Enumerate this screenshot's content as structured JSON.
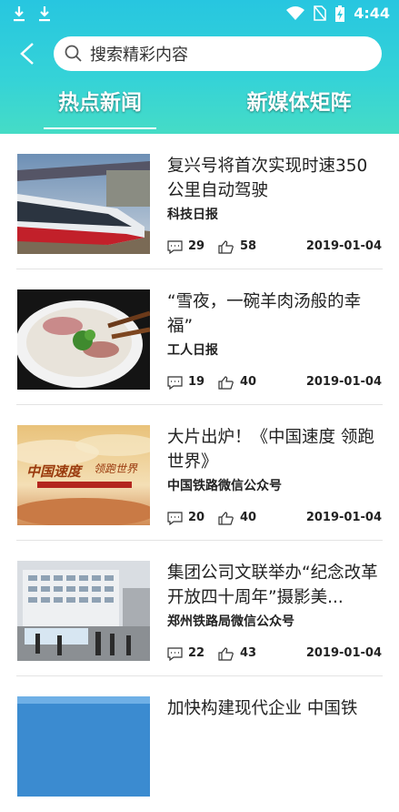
{
  "status": {
    "time": "4:44"
  },
  "search": {
    "placeholder": "搜索精彩内容"
  },
  "tabs": [
    {
      "label": "热点新闻",
      "active": true
    },
    {
      "label": "新媒体矩阵",
      "active": false
    }
  ],
  "colors": {
    "header_top": "#27c6e0",
    "header_bottom": "#45dcc6"
  },
  "articles": [
    {
      "title": "复兴号将首次实现时速350公里自动驾驶",
      "source": "科技日报",
      "comments": "29",
      "likes": "58",
      "date": "2019-01-04",
      "image": "high-speed-train"
    },
    {
      "title": "“雪夜，一碗羊肉汤般的幸福”",
      "source": "工人日报",
      "comments": "19",
      "likes": "40",
      "date": "2019-01-04",
      "image": "mutton-soup-bowl"
    },
    {
      "title": "大片出炉！《中国速度 领跑世界》",
      "source": "中国铁路微信公众号",
      "comments": "20",
      "likes": "40",
      "date": "2019-01-04",
      "image": "china-speed-banner"
    },
    {
      "title": "集团公司文联举办“纪念改革开放四十周年”摄影美...",
      "source": "郑州铁路局微信公众号",
      "comments": "22",
      "likes": "43",
      "date": "2019-01-04",
      "image": "exhibition-building"
    },
    {
      "title": "加快构建现代企业 中国铁",
      "image": "partial-thumbnail"
    }
  ]
}
